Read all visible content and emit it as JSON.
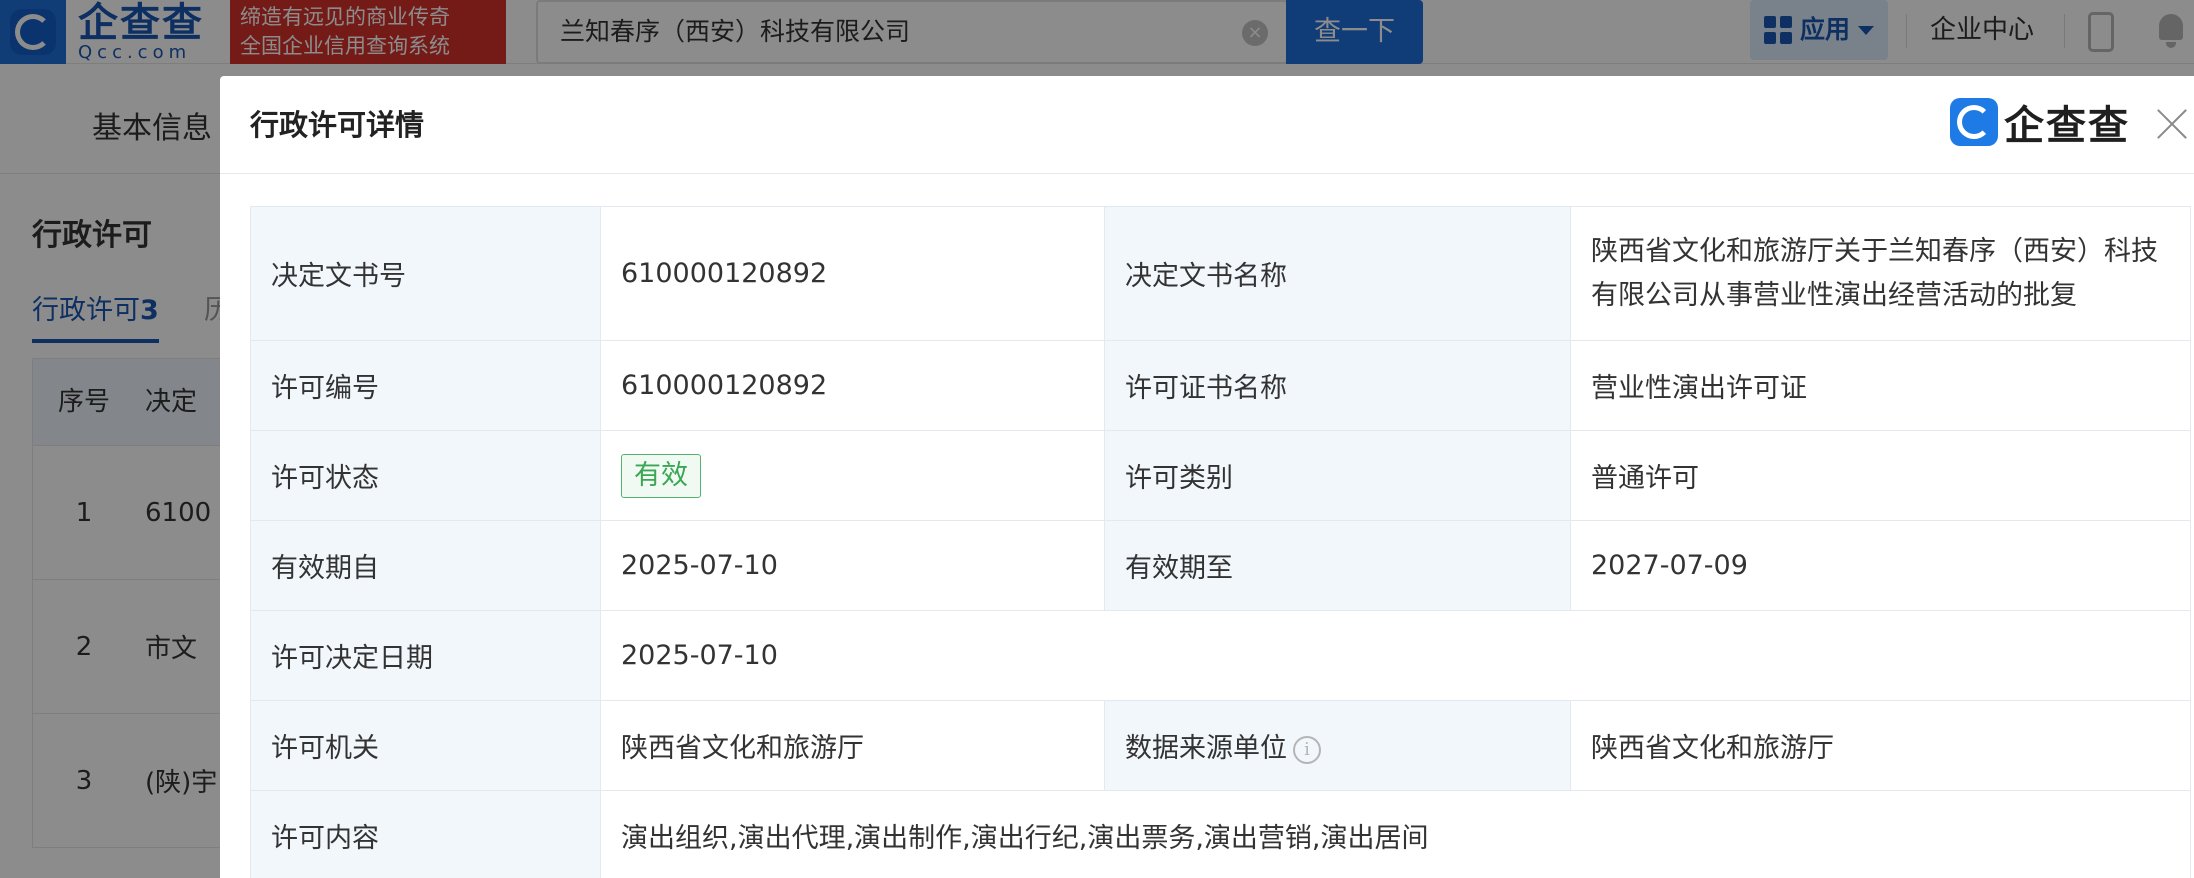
{
  "header": {
    "logo_cn": "企查查",
    "logo_en": "Qcc.com",
    "slogan_line1": "缔造有远见的商业传奇",
    "slogan_line2": "全国企业信用查询系统",
    "search_value": "兰知春序（西安）科技有限公司",
    "search_button": "查一下",
    "apps_label": "应用",
    "enterprise_center": "企业中心",
    "accent_color": "#1e6fd9",
    "slogan_color": "#d3302b"
  },
  "subnav": {
    "basic_info": "基本信息"
  },
  "section": {
    "title": "行政许可",
    "tab_label": "行政许可",
    "tab_count": "3",
    "tab2_label": "历",
    "table_headers": [
      "序号",
      "决定"
    ],
    "rows": [
      {
        "no": "1",
        "text": "6100"
      },
      {
        "no": "2",
        "text": "市文"
      },
      {
        "no": "3",
        "text": "(陕)宇"
      }
    ]
  },
  "modal": {
    "title": "行政许可详情",
    "brand_name": "企查查",
    "fields": {
      "decision_no_label": "决定文书号",
      "decision_no": "610000120892",
      "decision_name_label": "决定文书名称",
      "decision_name": "陕西省文化和旅游厅关于兰知春序（西安）科技有限公司从事营业性演出经营活动的批复",
      "license_no_label": "许可编号",
      "license_no": "610000120892",
      "cert_name_label": "许可证书名称",
      "cert_name": "营业性演出许可证",
      "status_label": "许可状态",
      "status": "有效",
      "category_label": "许可类别",
      "category": "普通许可",
      "valid_from_label": "有效期自",
      "valid_from": "2025-07-10",
      "valid_to_label": "有效期至",
      "valid_to": "2027-07-09",
      "decision_date_label": "许可决定日期",
      "decision_date": "2025-07-10",
      "authority_label": "许可机关",
      "authority": "陕西省文化和旅游厅",
      "source_label": "数据来源单位",
      "source": "陕西省文化和旅游厅",
      "content_label": "许可内容",
      "content": "演出组织,演出代理,演出制作,演出行纪,演出票务,演出营销,演出居间"
    },
    "status_color": "#3aa755"
  }
}
